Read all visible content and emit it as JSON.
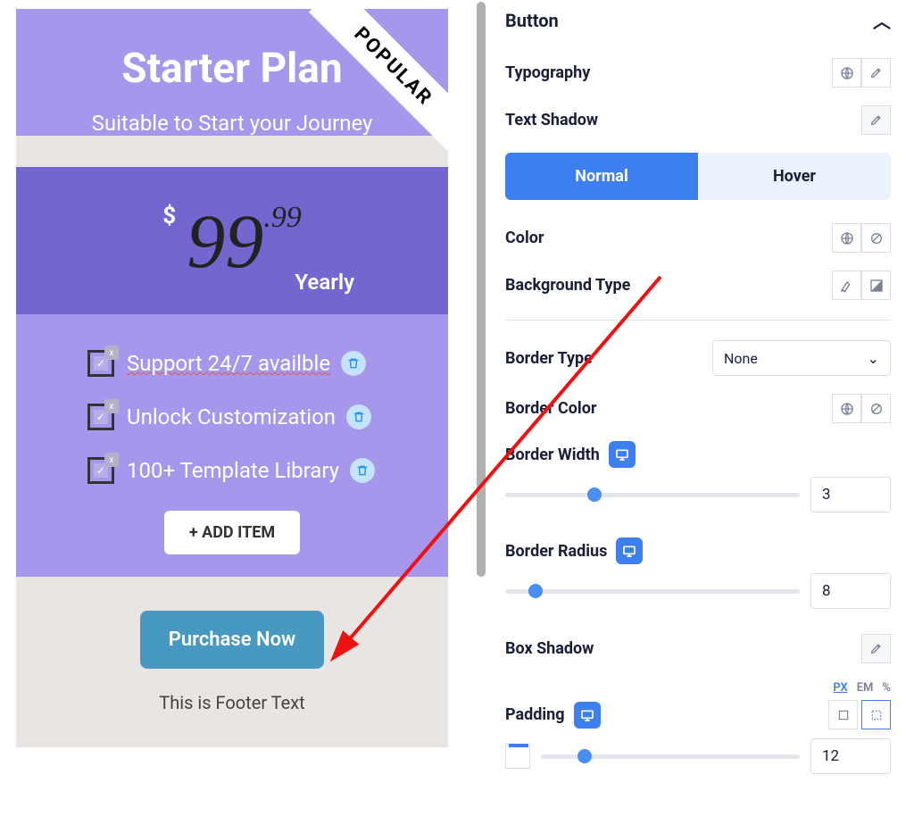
{
  "card": {
    "badge": "POPULAR",
    "title": "Starter Plan",
    "subtitle": "Suitable to Start your Journey",
    "price": {
      "currency": "$",
      "main": "99",
      "dec": ".99",
      "period": "Yearly"
    },
    "features": [
      {
        "text": "Support 24/7 availble",
        "spelling": true
      },
      {
        "text": "Unlock Customization",
        "spelling": false
      },
      {
        "text": "100+ Template Library",
        "spelling": false
      }
    ],
    "add_item": "+ ADD ITEM",
    "button": "Purchase Now",
    "footer": "This is Footer Text"
  },
  "panel": {
    "section": "Button",
    "typography": "Typography",
    "text_shadow": "Text Shadow",
    "tab_normal": "Normal",
    "tab_hover": "Hover",
    "color": "Color",
    "bg_type": "Background Type",
    "border_type": {
      "label": "Border Type",
      "value": "None"
    },
    "border_color": "Border Color",
    "border_width": {
      "label": "Border Width",
      "value": "3"
    },
    "border_radius": {
      "label": "Border Radius",
      "value": "8"
    },
    "box_shadow": "Box Shadow",
    "units": {
      "px": "PX",
      "em": "EM",
      "pct": "%"
    },
    "padding": {
      "label": "Padding",
      "value": "12"
    }
  }
}
